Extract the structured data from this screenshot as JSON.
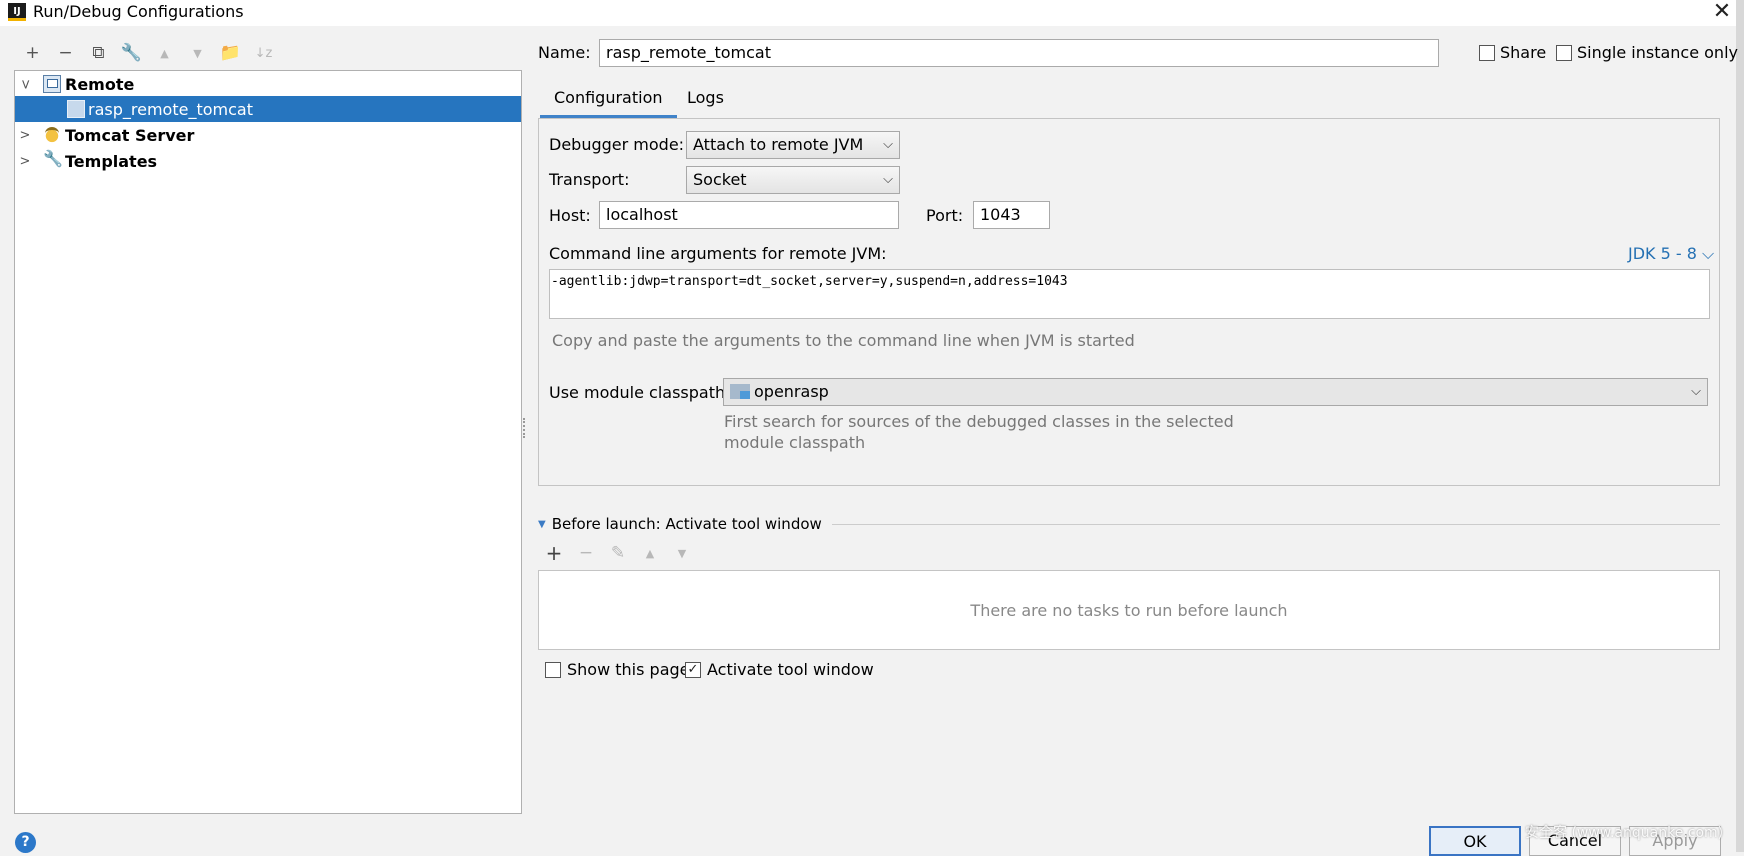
{
  "window": {
    "title": "Run/Debug Configurations",
    "app_icon_label": "IJ"
  },
  "left_toolbar": {
    "icons": [
      "add-icon",
      "remove-icon",
      "copy-icon",
      "wrench-icon",
      "move-up-icon",
      "move-down-icon",
      "folder-add-icon",
      "sort-icon"
    ],
    "glyphs": {
      "add": "+",
      "remove": "−",
      "copy": "⧉",
      "wrench": "🔧",
      "up": "▲",
      "down": "▼",
      "folder": "📁",
      "sort": "↓z"
    }
  },
  "tree": {
    "items": [
      {
        "label": "Remote",
        "icon": "remote-debug-icon",
        "expanded": true
      },
      {
        "label": "rasp_remote_tomcat",
        "icon": "remote-debug-icon",
        "selected": true
      },
      {
        "label": "Tomcat Server",
        "icon": "tomcat-icon",
        "expanded": false
      },
      {
        "label": "Templates",
        "icon": "wrench-icon",
        "expanded": false
      }
    ]
  },
  "header": {
    "name_label": "Name:",
    "name_value": "rasp_remote_tomcat",
    "share_label": "Share",
    "share_checked": false,
    "single_instance_label": "Single instance only",
    "single_instance_checked": false
  },
  "tabs": [
    {
      "label": "Configuration",
      "active": true
    },
    {
      "label": "Logs",
      "active": false
    }
  ],
  "config": {
    "debugger_mode_label": "Debugger mode:",
    "debugger_mode_value": "Attach to remote JVM",
    "transport_label": "Transport:",
    "transport_value": "Socket",
    "host_label": "Host:",
    "host_value": "localhost",
    "port_label": "Port:",
    "port_value": "1043",
    "cmdline_label": "Command line arguments for remote JVM:",
    "jdk_link": "JDK 5 - 8",
    "cmdline_value": "-agentlib:jdwp=transport=dt_socket,server=y,suspend=n,address=1043",
    "cmdline_hint": "Copy and paste the arguments to the command line when JVM is started",
    "module_label": "Use module classpath:",
    "module_value": "openrasp",
    "module_hint_1": "First search for sources of the debugged classes in the selected",
    "module_hint_2": "module classpath"
  },
  "before_launch": {
    "title": "Before launch: Activate tool window",
    "empty_text": "There are no tasks to run before launch",
    "show_page_label": "Show this page",
    "show_page_checked": false,
    "activate_label": "Activate tool window",
    "activate_checked": true
  },
  "buttons": {
    "ok": "OK",
    "cancel": "Cancel",
    "apply": "Apply"
  },
  "help_label": "?",
  "watermark": "安全客 (www.anquanke.com)",
  "colors": {
    "selection": "#2675bf",
    "accent": "#4083c9",
    "link": "#2470b3"
  }
}
